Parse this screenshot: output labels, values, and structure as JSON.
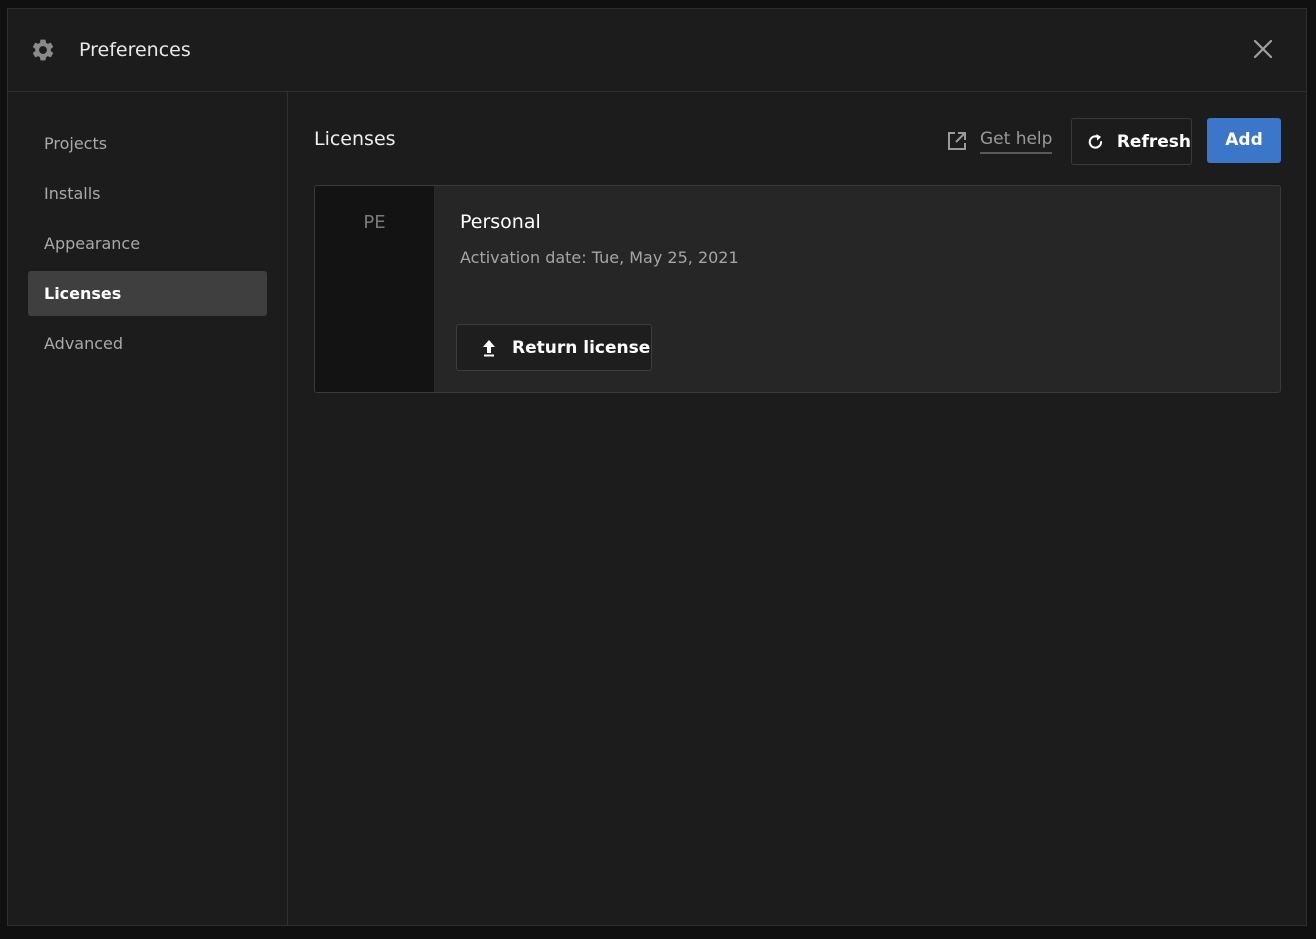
{
  "window": {
    "title": "Preferences",
    "icon": "gear-icon",
    "close_icon": "close-icon"
  },
  "sidebar": {
    "items": [
      {
        "label": "Projects",
        "active": false
      },
      {
        "label": "Installs",
        "active": false
      },
      {
        "label": "Appearance",
        "active": false
      },
      {
        "label": "Licenses",
        "active": true
      },
      {
        "label": "Advanced",
        "active": false
      }
    ]
  },
  "main": {
    "title": "Licenses",
    "get_help_label": "Get help",
    "get_help_icon": "external-link-icon",
    "refresh_label": "Refresh",
    "refresh_icon": "refresh-icon",
    "add_label": "Add",
    "licenses": [
      {
        "badge": "PE",
        "name": "Personal",
        "activation": "Activation date: Tue, May 25, 2021",
        "return_label": "Return license",
        "return_icon": "upload-arrow-icon"
      }
    ]
  },
  "colors": {
    "background": "#1c1c1c",
    "accent": "#3b76c9",
    "active_nav": "#3f3f3f"
  }
}
